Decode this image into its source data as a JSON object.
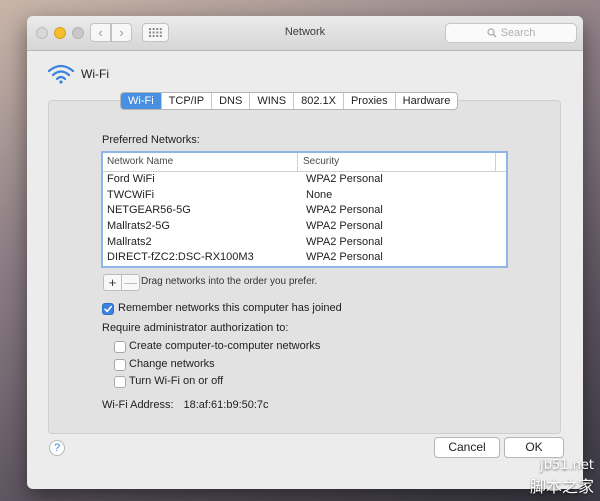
{
  "window": {
    "title": "Network"
  },
  "search": {
    "placeholder": "Search"
  },
  "header": {
    "label": "Wi-Fi"
  },
  "tabs": [
    {
      "label": "Wi-Fi",
      "active": true
    },
    {
      "label": "TCP/IP",
      "active": false
    },
    {
      "label": "DNS",
      "active": false
    },
    {
      "label": "WINS",
      "active": false
    },
    {
      "label": "802.1X",
      "active": false
    },
    {
      "label": "Proxies",
      "active": false
    },
    {
      "label": "Hardware",
      "active": false
    }
  ],
  "preferred": {
    "label": "Preferred Networks:",
    "columns": {
      "name": "Network Name",
      "security": "Security"
    },
    "rows": [
      {
        "name": "Ford WiFi",
        "security": "WPA2 Personal"
      },
      {
        "name": "TWCWiFi",
        "security": "None"
      },
      {
        "name": "NETGEAR56-5G",
        "security": "WPA2 Personal"
      },
      {
        "name": "Mallrats2-5G",
        "security": "WPA2 Personal"
      },
      {
        "name": "Mallrats2",
        "security": "WPA2 Personal"
      },
      {
        "name": "DIRECT-fZC2:DSC-RX100M3",
        "security": "WPA2 Personal"
      }
    ],
    "add_label": "+",
    "remove_label": "—",
    "drag_hint": "Drag networks into the order you prefer."
  },
  "options": {
    "remember": {
      "label": "Remember networks this computer has joined",
      "checked": true
    },
    "admin_label": "Require administrator authorization to:",
    "admin_items": [
      {
        "label": "Create computer-to-computer networks",
        "checked": false
      },
      {
        "label": "Change networks",
        "checked": false
      },
      {
        "label": "Turn Wi-Fi on or off",
        "checked": false
      }
    ]
  },
  "address": {
    "label": "Wi-Fi Address:",
    "value": "18:af:61:b9:50:7c"
  },
  "footer": {
    "help_label": "?",
    "cancel_label": "Cancel",
    "ok_label": "OK"
  },
  "watermark": {
    "line1": "jb51.net",
    "line2": "脚本之家"
  },
  "colors": {
    "accent": "#4a90e2",
    "checkbox_on": "#3b82e0",
    "list_focus": "#8fb5e8"
  }
}
